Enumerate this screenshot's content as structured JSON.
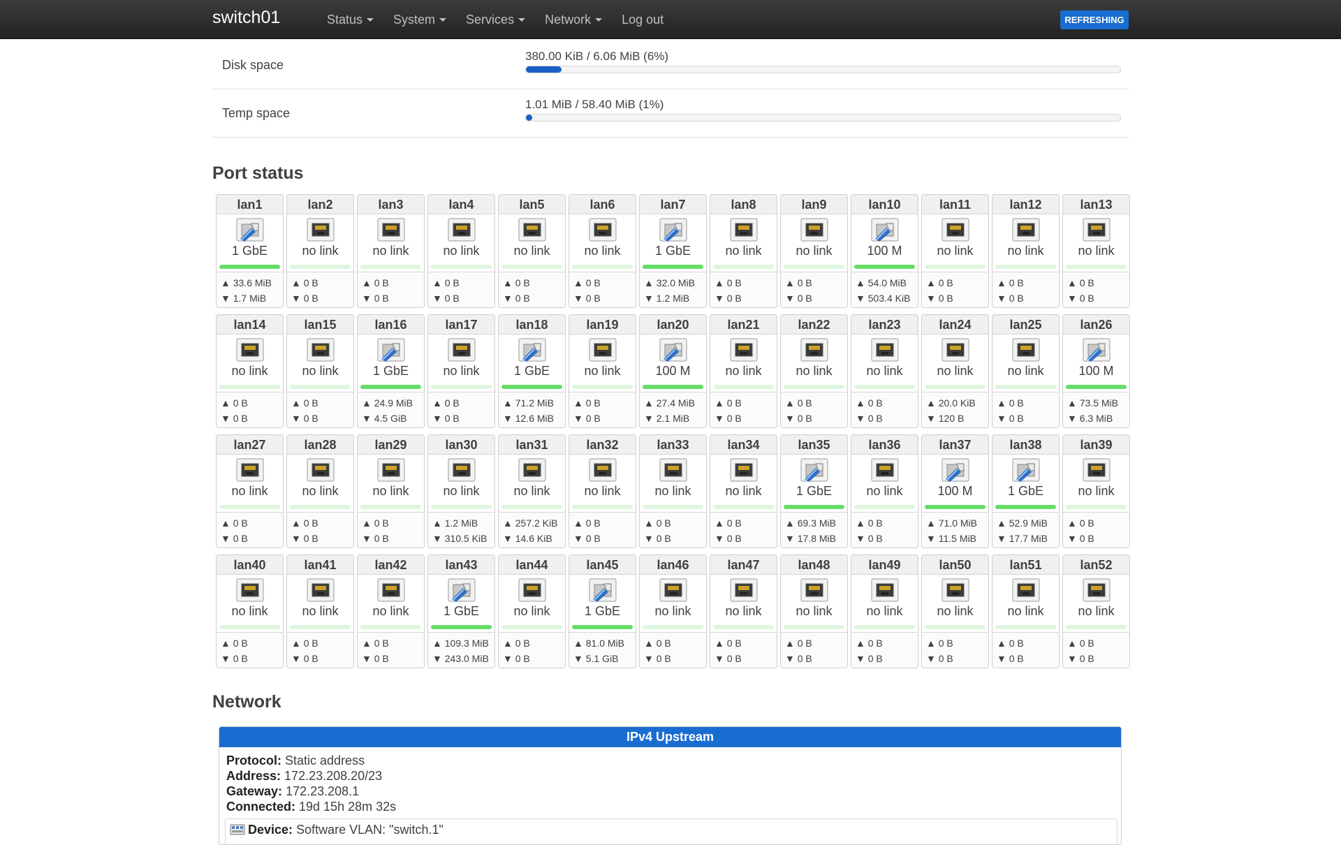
{
  "navbar": {
    "brand": "switch01",
    "menu": [
      {
        "label": "Status",
        "dropdown": true
      },
      {
        "label": "System",
        "dropdown": true
      },
      {
        "label": "Services",
        "dropdown": true
      },
      {
        "label": "Network",
        "dropdown": true
      },
      {
        "label": "Log out",
        "dropdown": false
      }
    ],
    "refresh_badge": "REFRESHING",
    "colors": {
      "bar": "#2b2b2b",
      "badge": "#1a6dd0"
    }
  },
  "storage": [
    {
      "label": "Disk space",
      "value": "380.00 KiB / 6.06 MiB (6%)",
      "percent": 6
    },
    {
      "label": "Temp space",
      "value": "1.01 MiB / 58.40 MiB (1%)",
      "percent": 1
    }
  ],
  "port_status": {
    "heading": "Port status",
    "link_up_icon": "ethernet-cable-connected-icon",
    "link_down_icon": "ethernet-port-empty-icon",
    "led_on_color": "#66dd66",
    "ports": [
      {
        "name": "lan1",
        "speed": "1 GbE",
        "link": true,
        "tx": "33.6 MiB",
        "rx": "1.7 MiB"
      },
      {
        "name": "lan2",
        "speed": "no link",
        "link": false,
        "tx": "0 B",
        "rx": "0 B"
      },
      {
        "name": "lan3",
        "speed": "no link",
        "link": false,
        "tx": "0 B",
        "rx": "0 B"
      },
      {
        "name": "lan4",
        "speed": "no link",
        "link": false,
        "tx": "0 B",
        "rx": "0 B"
      },
      {
        "name": "lan5",
        "speed": "no link",
        "link": false,
        "tx": "0 B",
        "rx": "0 B"
      },
      {
        "name": "lan6",
        "speed": "no link",
        "link": false,
        "tx": "0 B",
        "rx": "0 B"
      },
      {
        "name": "lan7",
        "speed": "1 GbE",
        "link": true,
        "tx": "32.0 MiB",
        "rx": "1.2 MiB"
      },
      {
        "name": "lan8",
        "speed": "no link",
        "link": false,
        "tx": "0 B",
        "rx": "0 B"
      },
      {
        "name": "lan9",
        "speed": "no link",
        "link": false,
        "tx": "0 B",
        "rx": "0 B"
      },
      {
        "name": "lan10",
        "speed": "100 M",
        "link": true,
        "tx": "54.0 MiB",
        "rx": "503.4 KiB"
      },
      {
        "name": "lan11",
        "speed": "no link",
        "link": false,
        "tx": "0 B",
        "rx": "0 B"
      },
      {
        "name": "lan12",
        "speed": "no link",
        "link": false,
        "tx": "0 B",
        "rx": "0 B"
      },
      {
        "name": "lan13",
        "speed": "no link",
        "link": false,
        "tx": "0 B",
        "rx": "0 B"
      },
      {
        "name": "lan14",
        "speed": "no link",
        "link": false,
        "tx": "0 B",
        "rx": "0 B"
      },
      {
        "name": "lan15",
        "speed": "no link",
        "link": false,
        "tx": "0 B",
        "rx": "0 B"
      },
      {
        "name": "lan16",
        "speed": "1 GbE",
        "link": true,
        "tx": "24.9 MiB",
        "rx": "4.5 GiB"
      },
      {
        "name": "lan17",
        "speed": "no link",
        "link": false,
        "tx": "0 B",
        "rx": "0 B"
      },
      {
        "name": "lan18",
        "speed": "1 GbE",
        "link": true,
        "tx": "71.2 MiB",
        "rx": "12.6 MiB"
      },
      {
        "name": "lan19",
        "speed": "no link",
        "link": false,
        "tx": "0 B",
        "rx": "0 B"
      },
      {
        "name": "lan20",
        "speed": "100 M",
        "link": true,
        "tx": "27.4 MiB",
        "rx": "2.1 MiB"
      },
      {
        "name": "lan21",
        "speed": "no link",
        "link": false,
        "tx": "0 B",
        "rx": "0 B"
      },
      {
        "name": "lan22",
        "speed": "no link",
        "link": false,
        "tx": "0 B",
        "rx": "0 B"
      },
      {
        "name": "lan23",
        "speed": "no link",
        "link": false,
        "tx": "0 B",
        "rx": "0 B"
      },
      {
        "name": "lan24",
        "speed": "no link",
        "link": false,
        "tx": "20.0 KiB",
        "rx": "120 B"
      },
      {
        "name": "lan25",
        "speed": "no link",
        "link": false,
        "tx": "0 B",
        "rx": "0 B"
      },
      {
        "name": "lan26",
        "speed": "100 M",
        "link": true,
        "tx": "73.5 MiB",
        "rx": "6.3 MiB"
      },
      {
        "name": "lan27",
        "speed": "no link",
        "link": false,
        "tx": "0 B",
        "rx": "0 B"
      },
      {
        "name": "lan28",
        "speed": "no link",
        "link": false,
        "tx": "0 B",
        "rx": "0 B"
      },
      {
        "name": "lan29",
        "speed": "no link",
        "link": false,
        "tx": "0 B",
        "rx": "0 B"
      },
      {
        "name": "lan30",
        "speed": "no link",
        "link": false,
        "tx": "1.2 MiB",
        "rx": "310.5 KiB"
      },
      {
        "name": "lan31",
        "speed": "no link",
        "link": false,
        "tx": "257.2 KiB",
        "rx": "14.6 KiB"
      },
      {
        "name": "lan32",
        "speed": "no link",
        "link": false,
        "tx": "0 B",
        "rx": "0 B"
      },
      {
        "name": "lan33",
        "speed": "no link",
        "link": false,
        "tx": "0 B",
        "rx": "0 B"
      },
      {
        "name": "lan34",
        "speed": "no link",
        "link": false,
        "tx": "0 B",
        "rx": "0 B"
      },
      {
        "name": "lan35",
        "speed": "1 GbE",
        "link": true,
        "tx": "69.3 MiB",
        "rx": "17.8 MiB"
      },
      {
        "name": "lan36",
        "speed": "no link",
        "link": false,
        "tx": "0 B",
        "rx": "0 B"
      },
      {
        "name": "lan37",
        "speed": "100 M",
        "link": true,
        "tx": "71.0 MiB",
        "rx": "11.5 MiB"
      },
      {
        "name": "lan38",
        "speed": "1 GbE",
        "link": true,
        "tx": "52.9 MiB",
        "rx": "17.7 MiB"
      },
      {
        "name": "lan39",
        "speed": "no link",
        "link": false,
        "tx": "0 B",
        "rx": "0 B"
      },
      {
        "name": "lan40",
        "speed": "no link",
        "link": false,
        "tx": "0 B",
        "rx": "0 B"
      },
      {
        "name": "lan41",
        "speed": "no link",
        "link": false,
        "tx": "0 B",
        "rx": "0 B"
      },
      {
        "name": "lan42",
        "speed": "no link",
        "link": false,
        "tx": "0 B",
        "rx": "0 B"
      },
      {
        "name": "lan43",
        "speed": "1 GbE",
        "link": true,
        "tx": "109.3 MiB",
        "rx": "243.0 MiB"
      },
      {
        "name": "lan44",
        "speed": "no link",
        "link": false,
        "tx": "0 B",
        "rx": "0 B"
      },
      {
        "name": "lan45",
        "speed": "1 GbE",
        "link": true,
        "tx": "81.0 MiB",
        "rx": "5.1 GiB"
      },
      {
        "name": "lan46",
        "speed": "no link",
        "link": false,
        "tx": "0 B",
        "rx": "0 B"
      },
      {
        "name": "lan47",
        "speed": "no link",
        "link": false,
        "tx": "0 B",
        "rx": "0 B"
      },
      {
        "name": "lan48",
        "speed": "no link",
        "link": false,
        "tx": "0 B",
        "rx": "0 B"
      },
      {
        "name": "lan49",
        "speed": "no link",
        "link": false,
        "tx": "0 B",
        "rx": "0 B"
      },
      {
        "name": "lan50",
        "speed": "no link",
        "link": false,
        "tx": "0 B",
        "rx": "0 B"
      },
      {
        "name": "lan51",
        "speed": "no link",
        "link": false,
        "tx": "0 B",
        "rx": "0 B"
      },
      {
        "name": "lan52",
        "speed": "no link",
        "link": false,
        "tx": "0 B",
        "rx": "0 B"
      }
    ]
  },
  "network": {
    "heading": "Network",
    "upstream_title": "IPv4 Upstream",
    "fields": [
      {
        "label": "Protocol:",
        "value": "Static address"
      },
      {
        "label": "Address:",
        "value": "172.23.208.20/23"
      },
      {
        "label": "Gateway:",
        "value": "172.23.208.1"
      },
      {
        "label": "Connected:",
        "value": "19d 15h 28m 32s"
      }
    ],
    "device": {
      "label": "Device:",
      "value": "Software VLAN: \"switch.1\"",
      "icon": "vlan-device-icon"
    }
  }
}
